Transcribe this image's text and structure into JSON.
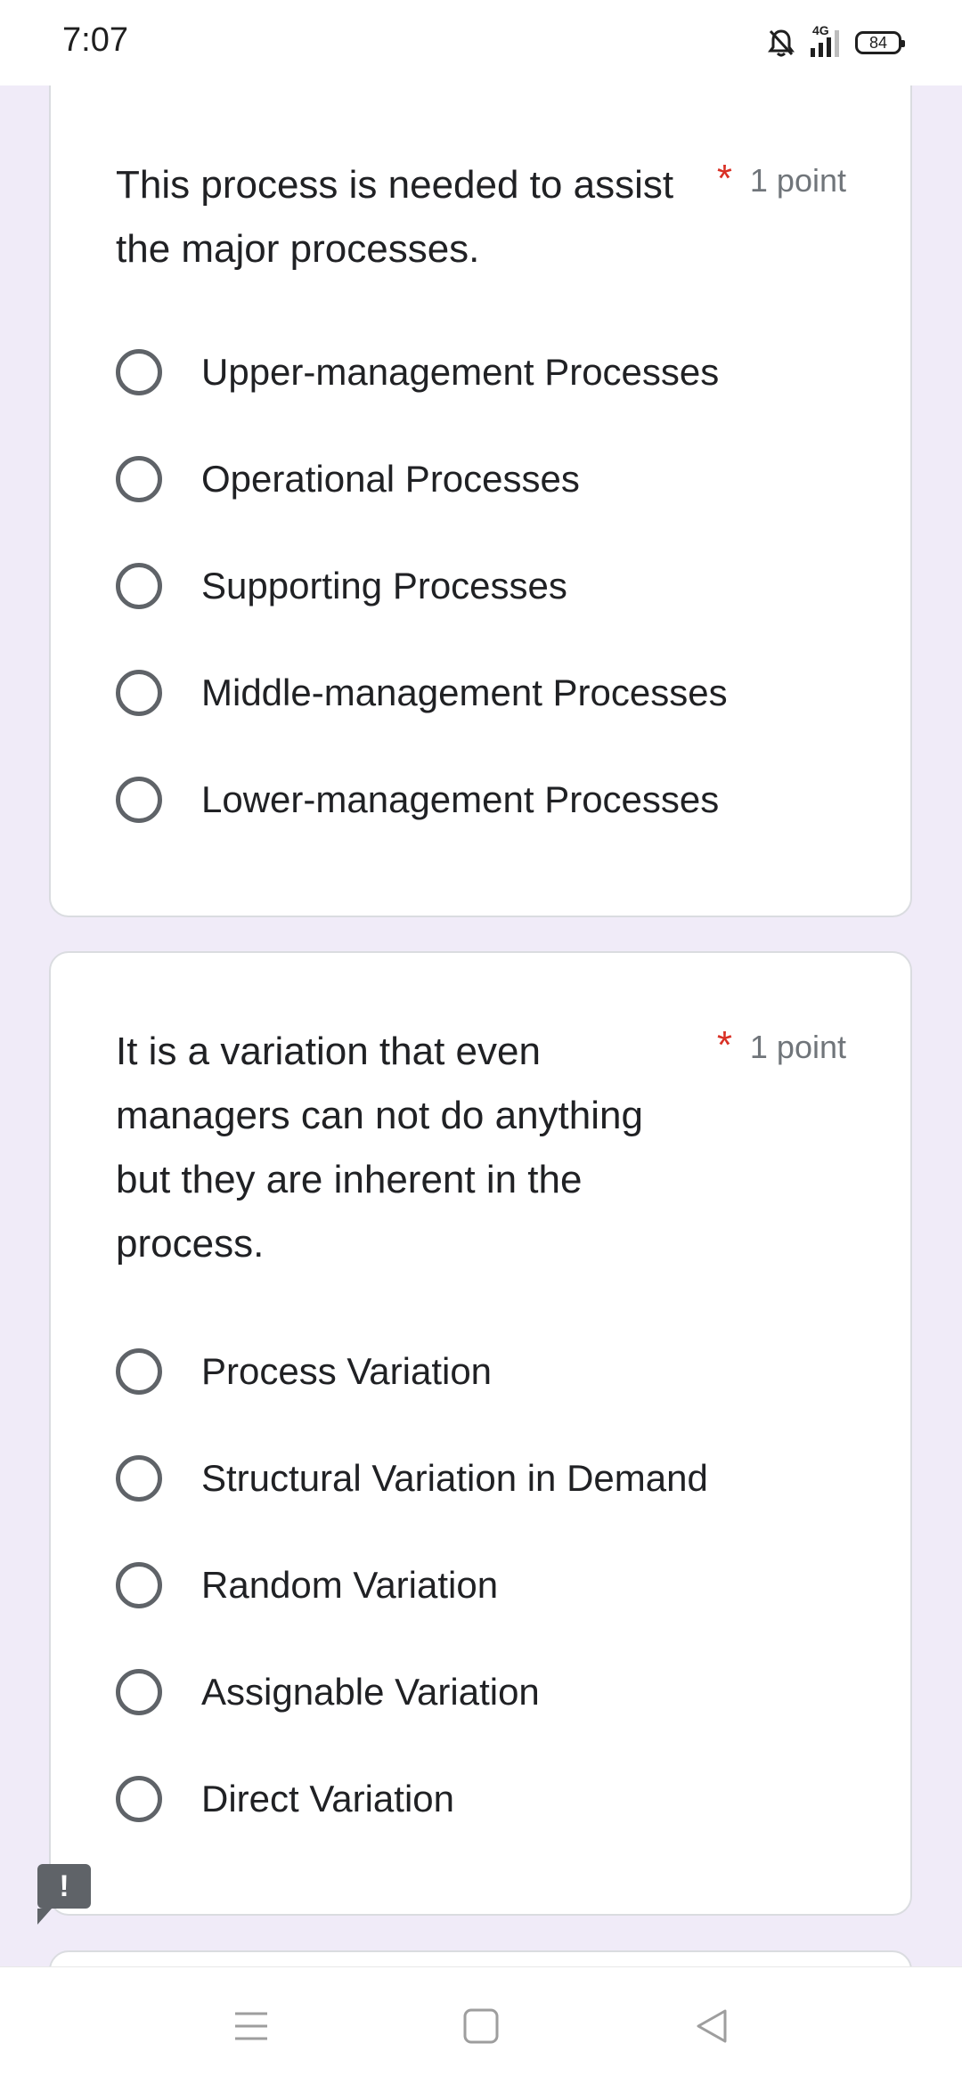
{
  "status_bar": {
    "time": "7:07",
    "signal": "4G",
    "battery": "84",
    "icons": [
      "bell-muted-icon",
      "signal-icon",
      "battery-icon"
    ]
  },
  "colors": {
    "background": "#f0ebf8",
    "card": "#ffffff",
    "required": "#d93025",
    "radio": "#5f6368"
  },
  "questions": [
    {
      "title": "This process is needed to assist the major processes.",
      "required": "*",
      "points": "1 point",
      "options": [
        "Upper-management Processes",
        "Operational Processes",
        "Supporting Processes",
        "Middle-management Processes",
        "Lower-management Processes"
      ]
    },
    {
      "title": "It is a variation that even managers can not do anything but they are inherent in the process.",
      "required": "*",
      "points": "1 point",
      "options": [
        "Process Variation",
        "Structural Variation in Demand",
        "Random Variation",
        "Assignable Variation",
        "Direct Variation"
      ]
    }
  ],
  "feedback": {
    "label": "!"
  },
  "nav": [
    "menu-icon",
    "home-icon",
    "back-icon"
  ]
}
